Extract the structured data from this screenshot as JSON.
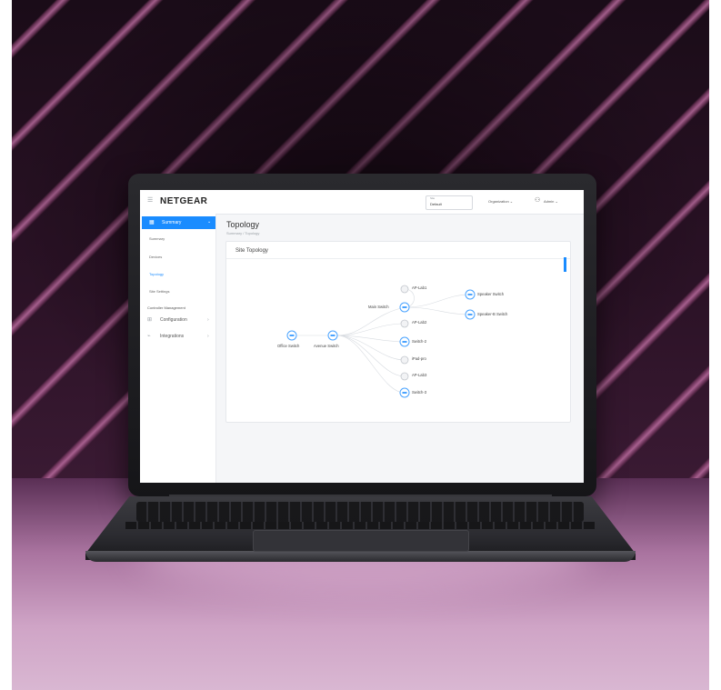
{
  "header": {
    "logo": "NETGEAR",
    "site_select_label": "Site",
    "site_select_value": "Default",
    "org_menu": "Organization ⌄",
    "user_menu": "Admin ⌄"
  },
  "sidebar": {
    "active_item": "Summary",
    "sub_items": [
      {
        "label": "Summary",
        "active": false
      },
      {
        "label": "Devices",
        "active": false
      },
      {
        "label": "Topology",
        "active": true
      },
      {
        "label": "Site Settings",
        "active": false
      }
    ],
    "section_label": "Controller Management",
    "items": [
      {
        "label": "Configuration"
      },
      {
        "label": "Integrations"
      }
    ]
  },
  "main": {
    "title": "Topology",
    "breadcrumb": "Summary / Topology",
    "card_title": "Site Topology"
  },
  "topology": {
    "nodes": [
      {
        "id": "office-switch",
        "label": "Office Switch",
        "type": "switch"
      },
      {
        "id": "avenue-switch",
        "label": "Avenue Switch",
        "type": "switch"
      },
      {
        "id": "main-switch",
        "label": "Main Switch",
        "type": "switch"
      },
      {
        "id": "ap-lab1",
        "label": "AP-Lab1",
        "type": "ap"
      },
      {
        "id": "ap-lab2",
        "label": "AP-Lab2",
        "type": "ap"
      },
      {
        "id": "switch-2",
        "label": "Switch-2",
        "type": "switch"
      },
      {
        "id": "ipad-pro",
        "label": "iPad-pro",
        "type": "device"
      },
      {
        "id": "ap-lab3",
        "label": "AP-Lab3",
        "type": "ap"
      },
      {
        "id": "switch-3",
        "label": "Switch-3",
        "type": "switch"
      },
      {
        "id": "speaker-switch",
        "label": "Speaker Switch",
        "type": "switch"
      },
      {
        "id": "speaker-b-switch",
        "label": "Speaker-B Switch",
        "type": "switch"
      }
    ]
  },
  "colors": {
    "accent": "#1a8cff",
    "node_ring": "#4aa3ff"
  },
  "icons": {
    "menu": "hamburger-icon",
    "dashboard": "grid-icon",
    "config": "sliders-icon",
    "integrations": "plug-icon",
    "user": "user-icon"
  }
}
